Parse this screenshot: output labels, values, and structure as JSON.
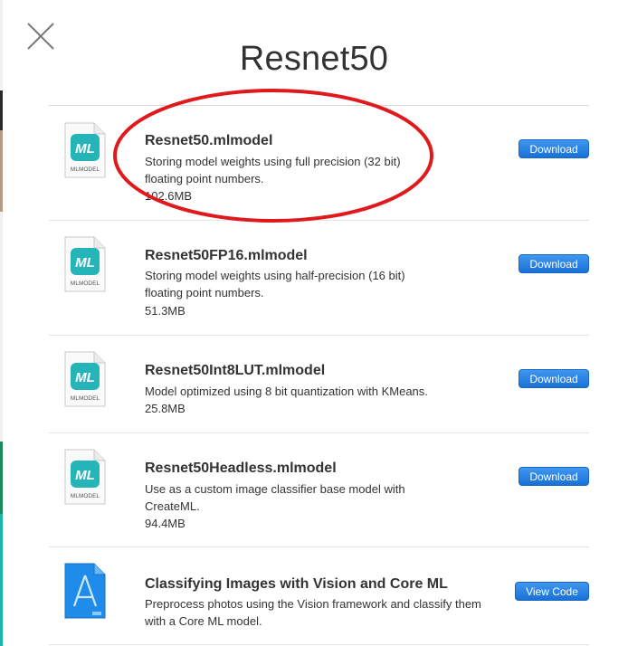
{
  "page": {
    "title": "Resnet50"
  },
  "colors": {
    "accent": "#1a71d6",
    "annotation": "#e0191c",
    "icon_teal": "#25b5b8",
    "icon_blue": "#1f8ce9"
  },
  "close": {
    "icon": "close-icon"
  },
  "items": [
    {
      "icon": "mlmodel-file-icon",
      "icon_caption": "MLMODEL",
      "name": "Resnet50.mlmodel",
      "desc_lines": [
        "Storing model weights using full precision (32 bit)",
        "floating point numbers."
      ],
      "size": "102.6MB",
      "action": "Download"
    },
    {
      "icon": "mlmodel-file-icon",
      "icon_caption": "MLMODEL",
      "name": "Resnet50FP16.mlmodel",
      "desc_lines": [
        "Storing model weights using half-precision (16 bit)",
        "floating point numbers."
      ],
      "size": "51.3MB",
      "action": "Download"
    },
    {
      "icon": "mlmodel-file-icon",
      "icon_caption": "MLMODEL",
      "name": "Resnet50Int8LUT.mlmodel",
      "desc_lines": [
        "Model optimized using 8 bit quantization with KMeans."
      ],
      "size": "25.8MB",
      "action": "Download"
    },
    {
      "icon": "mlmodel-file-icon",
      "icon_caption": "MLMODEL",
      "name": "Resnet50Headless.mlmodel",
      "desc_lines": [
        "Use as a custom image classifier base model with",
        "CreateML."
      ],
      "size": "94.4MB",
      "action": "Download"
    },
    {
      "icon": "xcode-project-icon",
      "name": "Classifying Images with Vision and Core ML",
      "desc_lines": [
        "Preprocess photos using the Vision framework and classify them",
        "with a Core ML model."
      ],
      "action": "View Code"
    }
  ]
}
